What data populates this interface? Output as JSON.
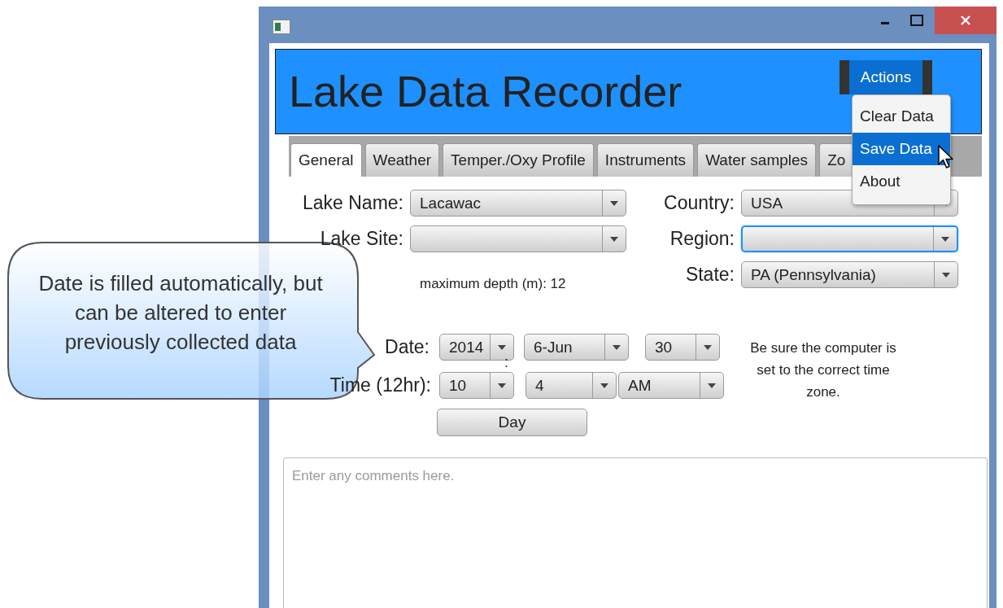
{
  "header": {
    "title": "Lake Data Recorder",
    "actions_button": "Actions"
  },
  "actions_menu": [
    {
      "label": "Clear Data",
      "selected": false
    },
    {
      "label": "Save Data",
      "selected": true
    },
    {
      "label": "About",
      "selected": false
    }
  ],
  "tabs": [
    {
      "label": "General",
      "selected": true
    },
    {
      "label": "Weather",
      "selected": false
    },
    {
      "label": "Temper./Oxy Profile",
      "selected": false
    },
    {
      "label": "Instruments",
      "selected": false
    },
    {
      "label": "Water samples",
      "selected": false
    },
    {
      "label": "Zo",
      "selected": false
    }
  ],
  "left_fields": [
    {
      "label": "Lake Name:",
      "value": "Lacawac",
      "focused": false
    },
    {
      "label": "Lake Site:",
      "focused": false
    }
  ],
  "depth_note": "maximum depth (m): 12",
  "right_fields": [
    {
      "label": "Country:",
      "value": "USA",
      "focused": false
    },
    {
      "label": "Region:",
      "focused": true
    },
    {
      "label": "State:",
      "value": "PA (Pennsylvania)",
      "focused": false
    }
  ],
  "date": {
    "label": "Date:",
    "parts": [
      "2014",
      "6-Jun",
      "30"
    ]
  },
  "time_separator": ":",
  "time": {
    "label": "Time (12hr):",
    "parts": [
      "10",
      "4",
      "AM"
    ]
  },
  "day_button": "Day",
  "timezone_note": "Be sure the computer is set to the correct time zone.",
  "comments": {
    "placeholder": "Enter any comments here."
  },
  "callout": "Date is filled automatically, but can be altered to enter previously collected data"
}
